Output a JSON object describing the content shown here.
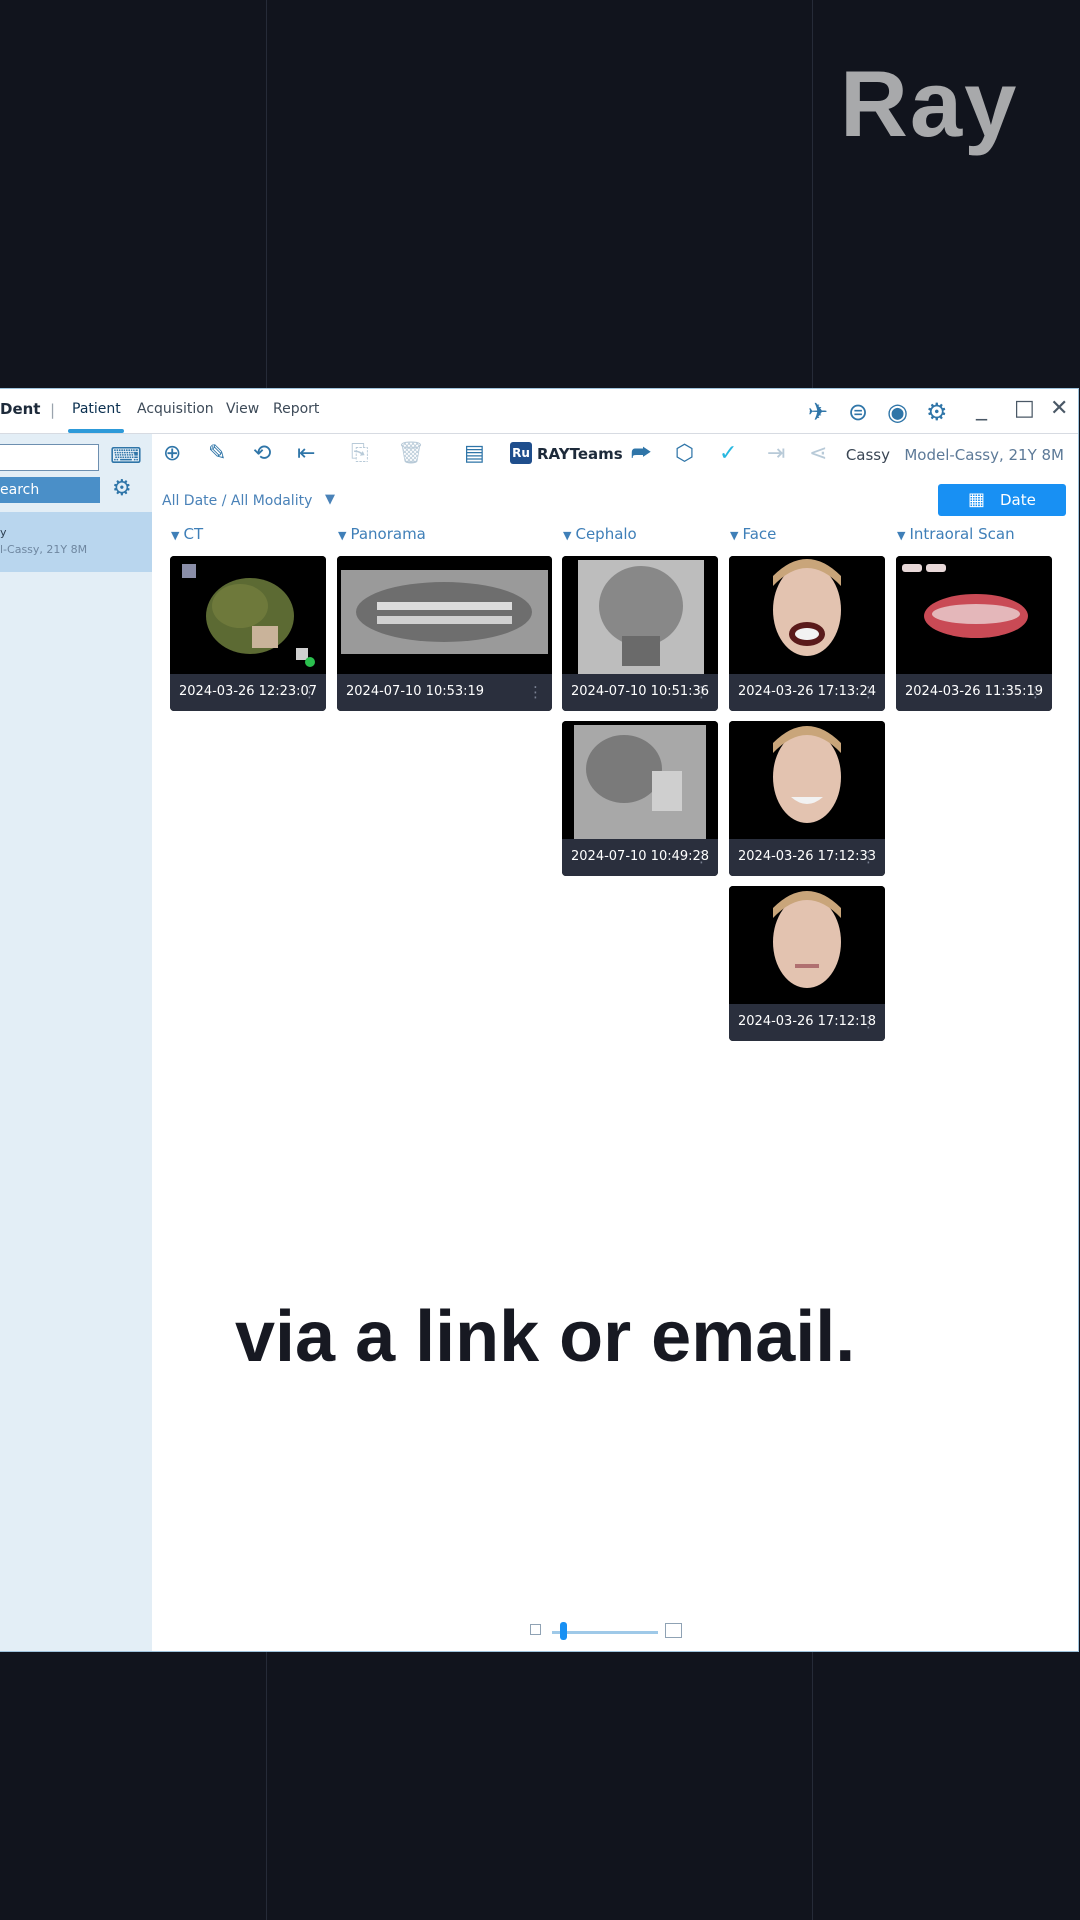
{
  "logo": "Ray",
  "app": {
    "brand": "Dent",
    "separator": "|",
    "menu": [
      "Patient",
      "Acquisition",
      "View",
      "Report"
    ]
  },
  "sidebar": {
    "search_label": "earch",
    "patient": {
      "name": "y",
      "sub": "l-Cassy, 21Y 8M"
    }
  },
  "toolbar": {
    "rayteams_logo": "Ru",
    "rayteams_label": "RAYTeams",
    "patient_name": "Cassy",
    "patient_detail": "Model-Cassy, 21Y 8M"
  },
  "filter": {
    "label": "All Date / All Modality",
    "caret": "▼"
  },
  "date_button": {
    "label": "Date"
  },
  "columns": [
    {
      "label": "CT"
    },
    {
      "label": "Panorama"
    },
    {
      "label": "Cephalo"
    },
    {
      "label": "Face"
    },
    {
      "label": "Intraoral Scan"
    }
  ],
  "studies": {
    "ct_1": "2024-03-26 12:23:07",
    "pano_1": "2024-07-10 10:53:19",
    "ceph_1": "2024-07-10 10:51:36",
    "ceph_2": "2024-07-10 10:49:28",
    "face_1": "2024-03-26 17:13:24",
    "face_2": "2024-03-26 17:12:33",
    "face_3": "2024-03-26 17:12:18",
    "ios_1": "2024-03-26 11:35:19"
  },
  "caption": "via a link or email.",
  "colors": {
    "accent": "#1890f3",
    "header_blue": "#3f7fb8",
    "sidebar": "#e3eef6",
    "background": "#11141d"
  }
}
